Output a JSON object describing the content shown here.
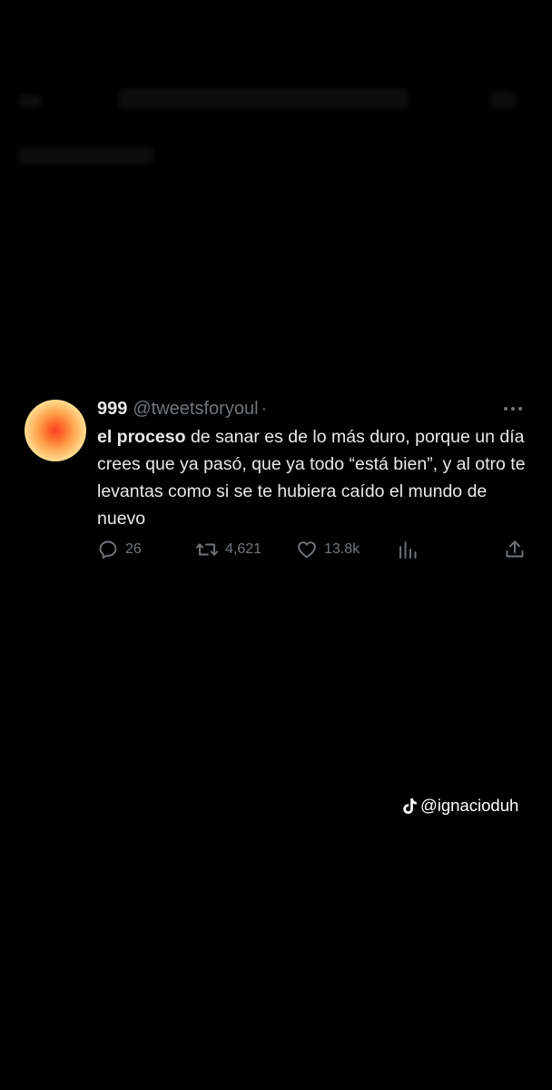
{
  "tweet": {
    "display_name": "999",
    "handle": "@tweetsforyoul",
    "separator": "·",
    "text_bold": "el proceso",
    "text_rest": " de sanar es de lo más duro, porque un día crees que ya pasó, que ya todo “está bien”, y al otro te levantas como si se te hubiera caído el mundo de nuevo",
    "actions": {
      "reply_count": "26",
      "retweet_count": "4,621",
      "like_count": "13.8k"
    }
  },
  "watermark": {
    "username": "@ignacioduh",
    "icon": "tiktok-logo"
  },
  "icons": {
    "more": "more-dots-icon",
    "reply": "reply-icon",
    "retweet": "retweet-icon",
    "like": "heart-icon",
    "views": "views-chart-icon",
    "share": "share-icon"
  },
  "colors": {
    "background": "#000000",
    "text": "#e7e9ea",
    "secondary": "#71767b"
  }
}
